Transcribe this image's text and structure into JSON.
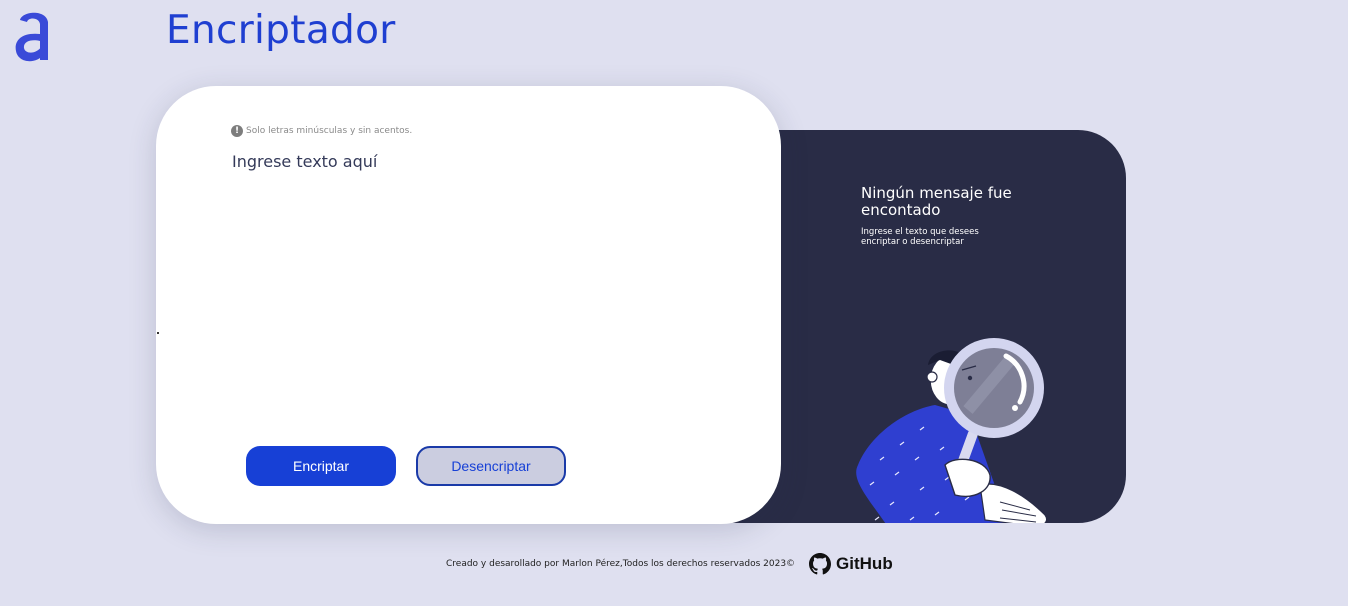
{
  "header": {
    "logo_icon": "letter-a-logo",
    "title": "Encriptador",
    "accent_color": "#1f3fd1"
  },
  "input_card": {
    "hint_icon": "exclamation-circle-icon",
    "hint_text": "Solo letras minúsculas y sin acentos.",
    "input_placeholder": "Ingrese texto aquí",
    "input_value": "",
    "encrypt_label": "Encriptar",
    "decrypt_label": "Desencriptar"
  },
  "result_panel": {
    "title": "Ningún mensaje fue encontado",
    "description": "Ingrese el texto que desees encriptar o desencriptar",
    "illustration": "person-with-magnifying-glass-illustration",
    "background_color": "#292c46"
  },
  "footer": {
    "text": "Creado y desarollado por Marlon Pérez,Todos los derechos reservados 2023©",
    "github_icon": "github-icon",
    "github_label": "GitHub"
  }
}
